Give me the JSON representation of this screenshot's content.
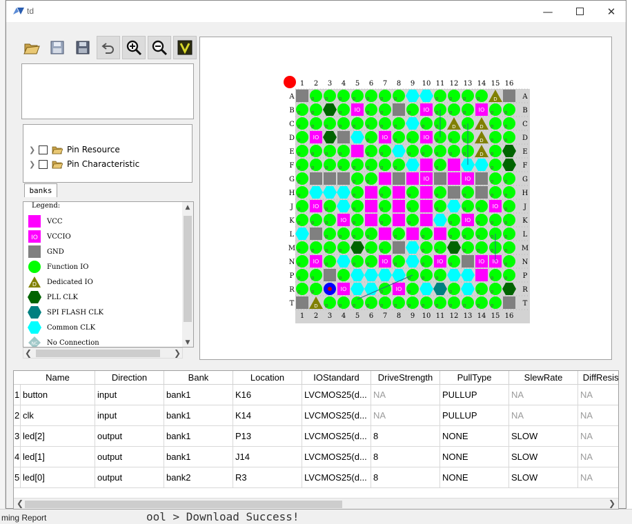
{
  "window": {
    "title": "td"
  },
  "bg_bottom": {
    "label": "ming Report",
    "console": "ool > Download Success!"
  },
  "tree": {
    "items": [
      {
        "label": "Pin Resource"
      },
      {
        "label": "Pin Characteristic"
      }
    ]
  },
  "tabs": {
    "banks": "banks"
  },
  "legend": {
    "title": "Legend:",
    "items": [
      {
        "label": "VCC",
        "icon": "magenta-square",
        "color": "#ff00ff"
      },
      {
        "label": "VCCIO",
        "icon": "magenta-io-square",
        "color": "#ff00ff"
      },
      {
        "label": "GND",
        "icon": "gray-square",
        "color": "#808080"
      },
      {
        "label": "Function IO",
        "icon": "green-circle",
        "color": "#00ff00"
      },
      {
        "label": "Dedicated IO",
        "icon": "olive-triangle",
        "color": "#808000"
      },
      {
        "label": "PLL CLK",
        "icon": "darkgreen-hexagon",
        "color": "#006400"
      },
      {
        "label": "SPI FLASH CLK",
        "icon": "teal-hexagon",
        "color": "#008080"
      },
      {
        "label": "Common CLK",
        "icon": "cyan-hexagon",
        "color": "#00ffff"
      },
      {
        "label": "No Connection",
        "icon": "nc-diamond",
        "color": "#a0c8c8"
      }
    ]
  },
  "chip": {
    "columns": [
      "1",
      "2",
      "3",
      "4",
      "5",
      "6",
      "7",
      "8",
      "9",
      "10",
      "11",
      "12",
      "13",
      "14",
      "15",
      "16"
    ],
    "rows": [
      "A",
      "B",
      "C",
      "D",
      "E",
      "F",
      "G",
      "H",
      "J",
      "K",
      "L",
      "M",
      "N",
      "P",
      "R",
      "T"
    ],
    "io_label": "IO",
    "dedicated_label": "D",
    "function_label": "p"
  },
  "table": {
    "headers": [
      "Name",
      "Direction",
      "Bank",
      "Location",
      "IOStandard",
      "DriveStrength",
      "PullType",
      "SlewRate",
      "DiffResist"
    ],
    "rows": [
      {
        "num": "1",
        "cells": [
          "button",
          "input",
          "bank1",
          "K16",
          "LVCMOS25(d...",
          "NA",
          "PULLUP",
          "NA",
          "NA"
        ]
      },
      {
        "num": "2",
        "cells": [
          "clk",
          "input",
          "bank1",
          "K14",
          "LVCMOS25(d...",
          "NA",
          "PULLUP",
          "NA",
          "NA"
        ]
      },
      {
        "num": "3",
        "cells": [
          "led[2]",
          "output",
          "bank1",
          "P13",
          "LVCMOS25(d...",
          "8",
          "NONE",
          "SLOW",
          "NA"
        ]
      },
      {
        "num": "4",
        "cells": [
          "led[1]",
          "output",
          "bank1",
          "J14",
          "LVCMOS25(d...",
          "8",
          "NONE",
          "SLOW",
          "NA"
        ]
      },
      {
        "num": "5",
        "cells": [
          "led[0]",
          "output",
          "bank2",
          "R3",
          "LVCMOS25(d...",
          "8",
          "NONE",
          "SLOW",
          "NA"
        ]
      }
    ]
  },
  "toolbar": {
    "icons": [
      "open-folder-icon",
      "save-icon",
      "save-as-icon",
      "undo-icon",
      "zoom-in-icon",
      "zoom-out-icon",
      "validate-icon"
    ]
  }
}
